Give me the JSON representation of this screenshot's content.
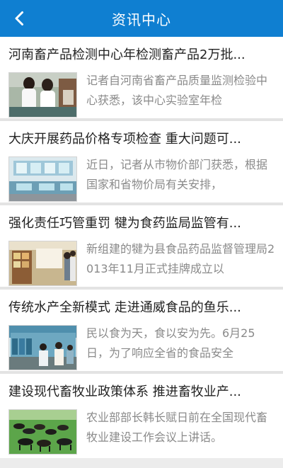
{
  "header": {
    "title": "资讯中心",
    "back_icon": "chevron-left-icon",
    "background_color": "#0f7fd1"
  },
  "news": [
    {
      "title": "河南畜产品检测中心年检测畜产品2万批...",
      "summary": "记者自河南省畜产品质量监测检验中心获悉，该中心实验室年检",
      "thumbnail": "lab-technicians-image"
    },
    {
      "title": "大庆开展药品价格专项检查 重大问题可...",
      "summary": "近日，记者从市物价部门获悉，根据国家和省物价局有关安排，",
      "thumbnail": "pharmacy-counter-image"
    },
    {
      "title": "强化责任巧管重罚 犍为食药监局监管有...",
      "summary": "新组建的犍为县食品药品监督管理局2013年11月正式挂牌成立以",
      "thumbnail": "office-inspection-image"
    },
    {
      "title": "传统水产全新模式 走进通威食品的鱼乐...",
      "summary": "民以食为天，食以安为先。6月25日，为了响应全省的食品安全",
      "thumbnail": "aquaculture-visit-image"
    },
    {
      "title": "建设现代畜牧业政策体系 推进畜牧业产...",
      "summary": "农业部部长韩长赋日前在全国现代畜牧业建设工作会议上讲话。",
      "thumbnail": "cattle-pasture-image"
    }
  ]
}
